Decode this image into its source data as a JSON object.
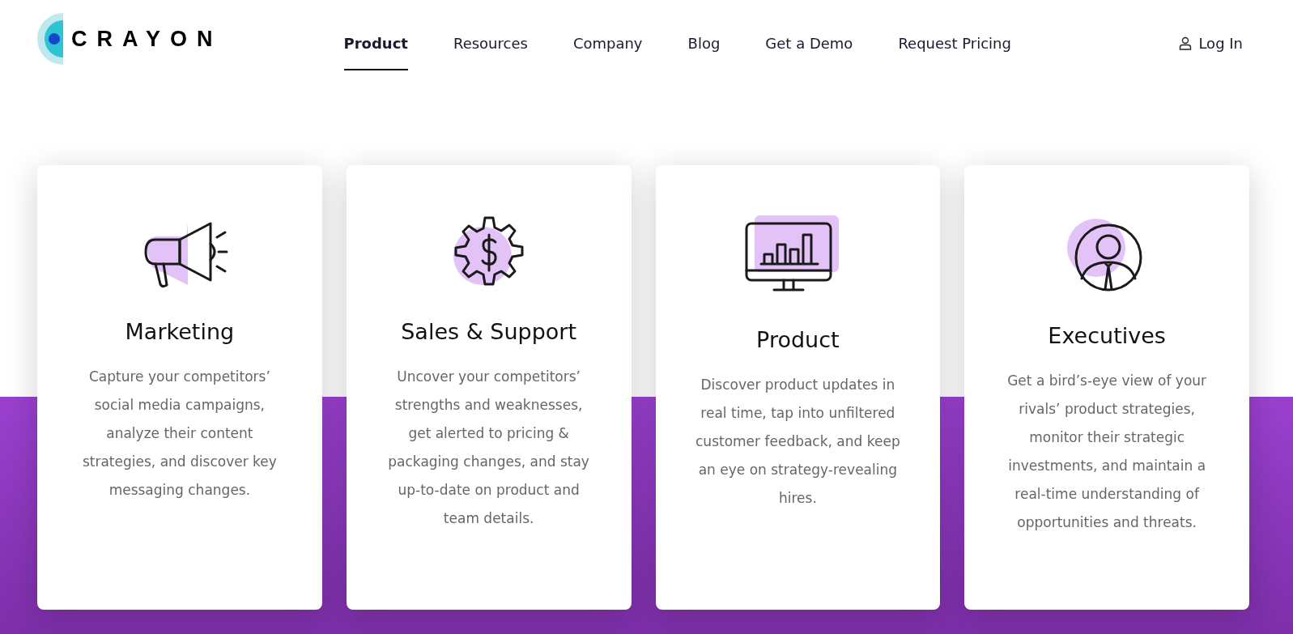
{
  "brand": {
    "name": "CRAYON"
  },
  "nav": [
    {
      "label": "Product",
      "selected": true
    },
    {
      "label": "Resources",
      "selected": false
    },
    {
      "label": "Company",
      "selected": false
    },
    {
      "label": "Blog",
      "selected": false
    },
    {
      "label": "Get a Demo",
      "selected": false
    },
    {
      "label": "Request Pricing",
      "selected": false
    }
  ],
  "login": {
    "label": "Log In"
  },
  "cards": [
    {
      "kind": "megaphone",
      "title": "Marketing",
      "text": "Capture your competitors’ social media campaigns, analyze their content strategies, and discover key messaging changes."
    },
    {
      "kind": "gear",
      "title": "Sales & Support",
      "text": "Uncover your competitors’ strengths and weaknesses, get alerted to pricing & packaging changes, and stay up-to-date on product and team details."
    },
    {
      "kind": "monitor",
      "title": "Product",
      "text": "Discover product updates in real time, tap into unfiltered customer feedback, and keep an eye on strategy-revealing hires."
    },
    {
      "kind": "person",
      "title": "Executives",
      "text": "Get a bird’s-eye view of your rivals’ product strategies, monitor their strategic investments, and maintain a real-time understanding of opportunities and threats."
    }
  ]
}
